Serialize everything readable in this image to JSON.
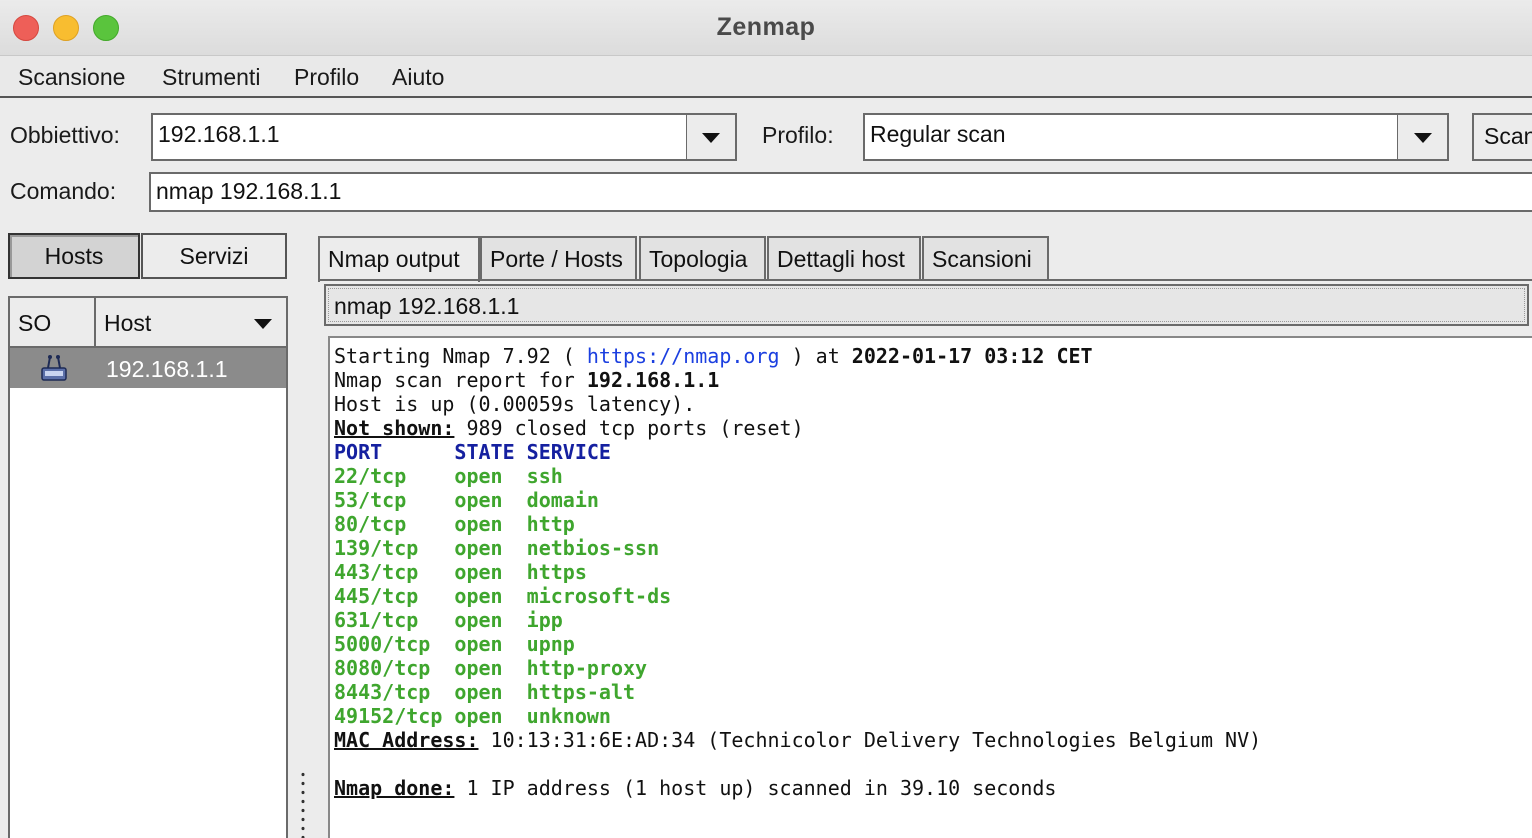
{
  "window": {
    "title": "Zenmap"
  },
  "menu": [
    "Scansione",
    "Strumenti",
    "Profilo",
    "Aiuto"
  ],
  "target": {
    "label": "Obbiettivo:",
    "value": "192.168.1.1"
  },
  "profile": {
    "label": "Profilo:",
    "value": "Regular scan"
  },
  "scan_button": "Scan",
  "command": {
    "label": "Comando:",
    "value": "nmap 192.168.1.1"
  },
  "side_tabs": {
    "hosts": "Hosts",
    "services": "Servizi"
  },
  "host_list": {
    "col_os": "SO",
    "col_host": "Host",
    "rows": [
      {
        "ip": "192.168.1.1",
        "icon": "network-device-icon"
      }
    ]
  },
  "tabs": [
    "Nmap output",
    "Porte / Hosts",
    "Topologia",
    "Dettagli host",
    "Scansioni"
  ],
  "output_command": "nmap 192.168.1.1",
  "output": {
    "start_prefix": "Starting Nmap 7.92 ( ",
    "url": "https://nmap.org",
    "start_mid": " ) at ",
    "start_time": "2022-01-17 03:12 CET",
    "report_prefix": "Nmap scan report for ",
    "report_host": "192.168.1.1",
    "host_up": "Host is up (0.00059s latency).",
    "not_shown_label": "Not shown:",
    "not_shown_text": " 989 closed tcp ports (reset)",
    "header": {
      "port": "PORT",
      "state": "STATE",
      "service": "SERVICE"
    },
    "ports": [
      {
        "port": "22/tcp",
        "state": "open",
        "service": "ssh"
      },
      {
        "port": "53/tcp",
        "state": "open",
        "service": "domain"
      },
      {
        "port": "80/tcp",
        "state": "open",
        "service": "http"
      },
      {
        "port": "139/tcp",
        "state": "open",
        "service": "netbios-ssn"
      },
      {
        "port": "443/tcp",
        "state": "open",
        "service": "https"
      },
      {
        "port": "445/tcp",
        "state": "open",
        "service": "microsoft-ds"
      },
      {
        "port": "631/tcp",
        "state": "open",
        "service": "ipp"
      },
      {
        "port": "5000/tcp",
        "state": "open",
        "service": "upnp"
      },
      {
        "port": "8080/tcp",
        "state": "open",
        "service": "http-proxy"
      },
      {
        "port": "8443/tcp",
        "state": "open",
        "service": "https-alt"
      },
      {
        "port": "49152/tcp",
        "state": "open",
        "service": "unknown"
      }
    ],
    "mac_label": "MAC Address:",
    "mac_text": " 10:13:31:6E:AD:34 (Technicolor Delivery Technologies Belgium NV)",
    "done_label": "Nmap done:",
    "done_text": " 1 IP address (1 host up) scanned in 39.10 seconds"
  },
  "colors": {
    "link": "#1b3fe0",
    "header": "#1520a0",
    "open_port": "#3fa62e",
    "selected_row": "#8b8b8b"
  }
}
